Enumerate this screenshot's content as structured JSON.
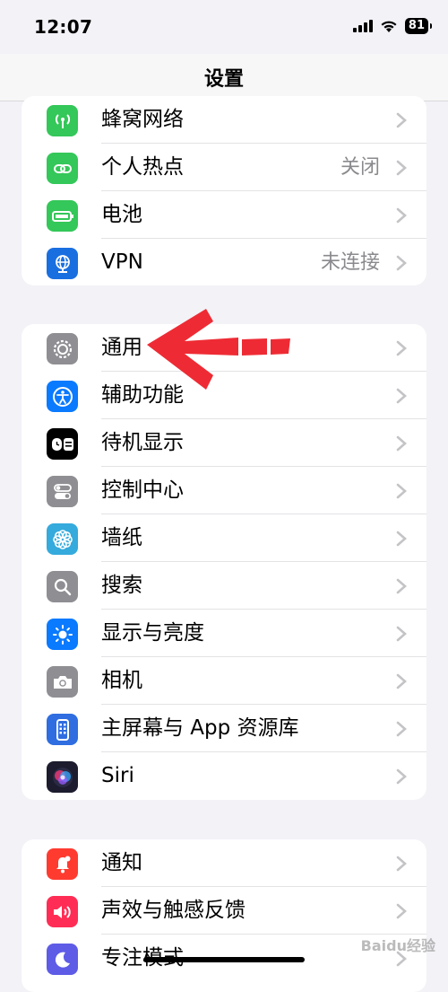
{
  "status_bar": {
    "time": "12:07",
    "battery": "81"
  },
  "nav": {
    "title": "设置"
  },
  "group1": [
    {
      "label": "蜂窝网络",
      "value": "",
      "color": "#34c759",
      "icon": "antenna-icon"
    },
    {
      "label": "个人热点",
      "value": "关闭",
      "color": "#34c759",
      "icon": "link-icon"
    },
    {
      "label": "电池",
      "value": "",
      "color": "#34c759",
      "icon": "battery-icon"
    },
    {
      "label": "VPN",
      "value": "未连接",
      "color": "#1a6fe0",
      "icon": "globe-icon"
    }
  ],
  "group2": [
    {
      "label": "通用",
      "color": "#8e8e93",
      "icon": "gear-icon"
    },
    {
      "label": "辅助功能",
      "color": "#0a7aff",
      "icon": "accessibility-icon"
    },
    {
      "label": "待机显示",
      "color": "#000000",
      "icon": "standby-icon"
    },
    {
      "label": "控制中心",
      "color": "#8e8e93",
      "icon": "toggles-icon"
    },
    {
      "label": "墙纸",
      "color": "#35aadc",
      "icon": "flower-icon"
    },
    {
      "label": "搜索",
      "color": "#8e8e93",
      "icon": "search-icon"
    },
    {
      "label": "显示与亮度",
      "color": "#0a7aff",
      "icon": "sun-icon"
    },
    {
      "label": "相机",
      "color": "#8e8e93",
      "icon": "camera-icon"
    },
    {
      "label": "主屏幕与 App 资源库",
      "color": "#2f6de0",
      "icon": "home-screen-icon"
    },
    {
      "label": "Siri",
      "color": "#1c1c2e",
      "icon": "siri-icon"
    }
  ],
  "group3": [
    {
      "label": "通知",
      "color": "#ff3b30",
      "icon": "bell-icon"
    },
    {
      "label": "声效与触感反馈",
      "color": "#ff2d55",
      "icon": "speaker-icon"
    },
    {
      "label": "专注模式",
      "color": "#5e5ce6",
      "icon": "moon-icon"
    }
  ],
  "watermark": "Baidu经验"
}
